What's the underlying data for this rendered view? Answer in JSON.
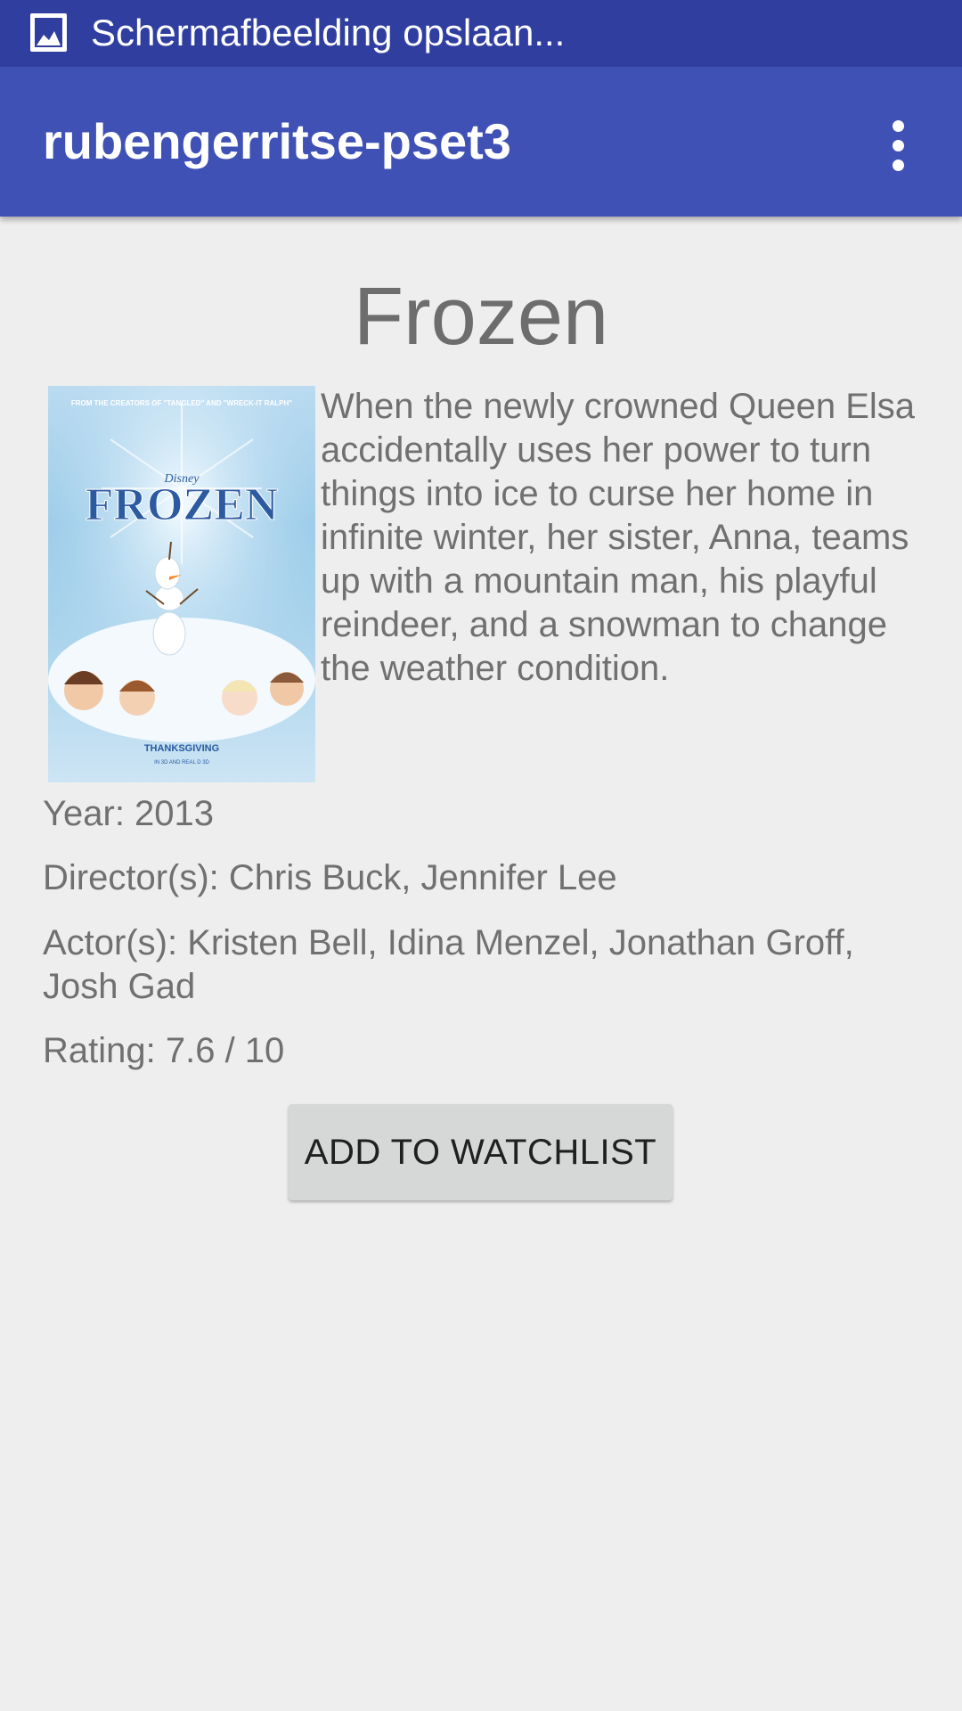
{
  "status_bar": {
    "notification_icon": "image-icon",
    "text": "Schermafbeelding opslaan..."
  },
  "app_bar": {
    "title": "rubengerritse-pset3",
    "overflow_icon": "more-vert-icon"
  },
  "movie": {
    "title": "Frozen",
    "plot": "When the newly crowned Queen Elsa accidentally uses her power to turn things into ice to curse her home in infinite winter, her sister, Anna, teams up with a mountain man, his playful reindeer, and a snowman to change the weather condition.",
    "year": "Year: 2013",
    "directors": "Director(s): Chris Buck, Jennifer Lee",
    "actors": "Actor(s): Kristen Bell, Idina Menzel, Jonathan Groff, Josh Gad",
    "rating": "Rating: 7.6 / 10",
    "poster": {
      "tagline": "FROM THE CREATORS OF \"TANGLED\" AND \"WRECK-IT RALPH\"",
      "studio": "Disney",
      "title": "FROZEN",
      "release": "THANKSGIVING",
      "formats": "IN 3D AND REAL D 3D"
    }
  },
  "actions": {
    "add_to_watchlist": "ADD TO WATCHLIST"
  },
  "colors": {
    "status_bar": "#303f9f",
    "app_bar": "#3f51b5",
    "background": "#eeeeee",
    "button": "#d6d7d7"
  }
}
